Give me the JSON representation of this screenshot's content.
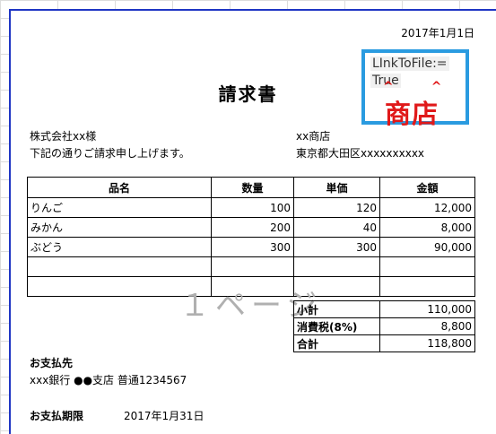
{
  "invoice": {
    "date": "2017年1月1日",
    "title": "請求書",
    "customer": "株式会社xx様",
    "greeting": "下記の通りご請求申し上げます。",
    "shop_name": "xx商店",
    "shop_address": "東京都大田区xxxxxxxxxx"
  },
  "stamp": {
    "line1": "LInkToFile:=",
    "line2": "True",
    "text": "商店",
    "color": "#e0191a",
    "border_color": "#2a9be0"
  },
  "table": {
    "headers": [
      "品名",
      "数量",
      "単価",
      "金額"
    ],
    "rows": [
      [
        "りんご",
        "100",
        "120",
        "12,000"
      ],
      [
        "みかん",
        "200",
        "40",
        "8,000"
      ],
      [
        "ぶどう",
        "300",
        "300",
        "90,000"
      ],
      [
        "",
        "",
        "",
        ""
      ],
      [
        "",
        "",
        "",
        ""
      ]
    ]
  },
  "totals": [
    {
      "label": "小計",
      "value": "110,000"
    },
    {
      "label": "消費税(8%)",
      "value": "8,800"
    },
    {
      "label": "合計",
      "value": "118,800"
    }
  ],
  "watermark": "１ページ",
  "payment": {
    "heading": "お支払先",
    "bank": "xxx銀行 ●●支店 普通1234567",
    "due_heading": "お支払期限",
    "due_date": "2017年1月31日"
  }
}
